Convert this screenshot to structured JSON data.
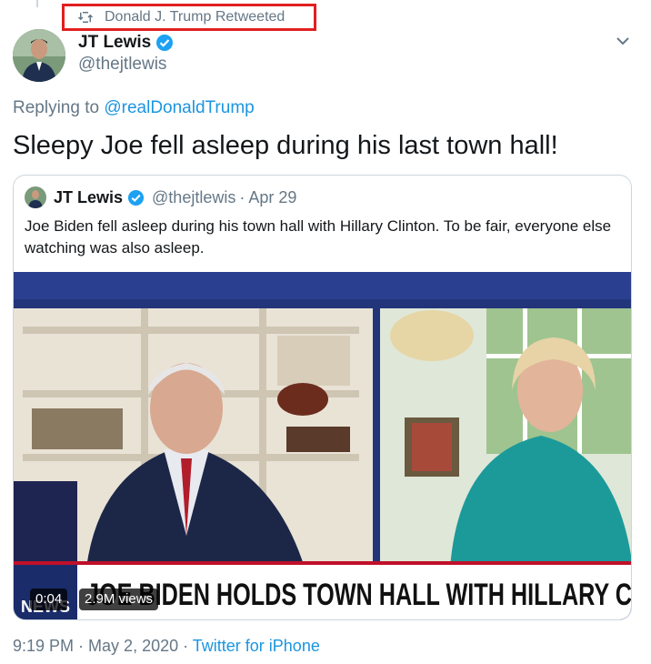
{
  "retweet": {
    "label": "Donald J. Trump Retweeted",
    "icon": "retweet-icon"
  },
  "author": {
    "name": "JT Lewis",
    "handle": "@thejtlewis",
    "verified": true
  },
  "reply": {
    "prefix": "Replying to ",
    "mention": "@realDonaldTrump"
  },
  "tweet": {
    "text": "Sleepy Joe fell asleep during his last town hall!"
  },
  "quoted": {
    "name": "JT Lewis",
    "handle": "@thejtlewis",
    "separator": "·",
    "date": "Apr 29",
    "text": "Joe Biden fell asleep during his town hall with Hillary Clinton. To be fair, everyone else watching was also asleep."
  },
  "video": {
    "duration": "0:04",
    "views": "2.9M views",
    "chyron": "JOE BIDEN HOLDS TOWN HALL WITH HILLARY C",
    "network_logo": "NEWS"
  },
  "footer": {
    "time": "9:19 PM",
    "separator": " · ",
    "date": "May 2, 2020",
    "source": "Twitter for iPhone"
  },
  "colors": {
    "accent": "#1b95e0",
    "highlight_box": "#e0201f",
    "muted": "#657786"
  }
}
